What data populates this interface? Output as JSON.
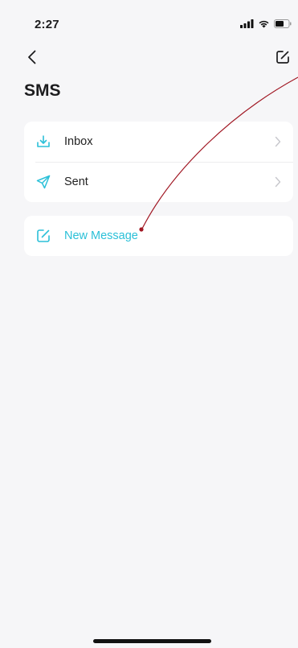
{
  "status_bar": {
    "time": "2:27"
  },
  "header": {
    "title": "SMS"
  },
  "menu": {
    "items": [
      {
        "label": "Inbox",
        "icon": "download-icon"
      },
      {
        "label": "Sent",
        "icon": "send-icon"
      }
    ]
  },
  "new_message": {
    "label": "New Message",
    "icon": "compose-icon"
  },
  "colors": {
    "accent": "#2bc0d8",
    "annotation": "#a01622"
  }
}
